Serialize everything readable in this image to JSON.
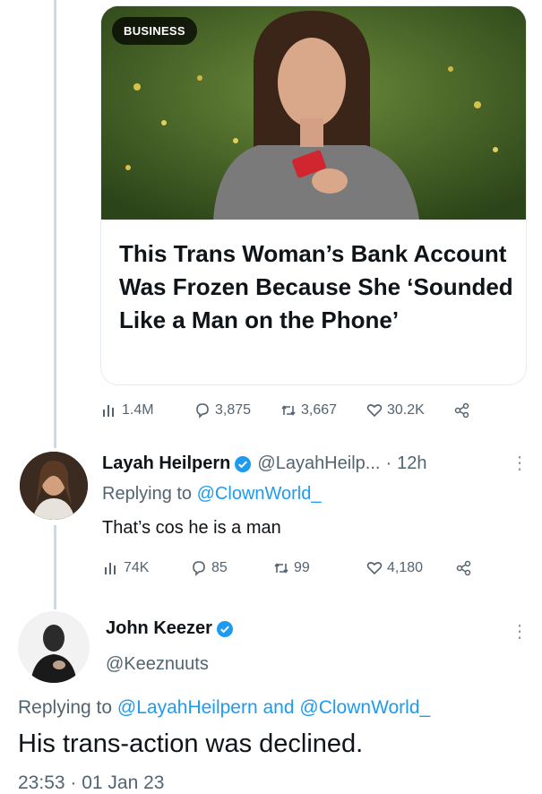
{
  "colors": {
    "link": "#1d9bf0",
    "muted": "#536471",
    "verified": "#1d9bf0",
    "thread_line": "#cfd9de"
  },
  "article_card": {
    "badge": "BUSINESS",
    "headline": "This Trans Woman’s Bank Account Was Frozen Because She ‘Sounded Like a Man on the Phone’"
  },
  "original_tweet_stats": {
    "views": "1.4M",
    "replies": "3,875",
    "retweets": "3,667",
    "likes": "30.2K"
  },
  "reply_1": {
    "name": "Layah Heilpern",
    "handle": "@LayahHeilp...",
    "separator": "·",
    "time": "12h",
    "replying_prefix": "Replying to",
    "replying_to": "@ClownWorld_",
    "text": "That’s cos he is a man",
    "stats": {
      "views": "74K",
      "replies": "85",
      "retweets": "99",
      "likes": "4,180"
    }
  },
  "reply_2": {
    "name": "John Keezer",
    "handle": "@Keeznuuts",
    "replying_prefix": "Replying to",
    "replying_user_1": "@LayahHeilpern",
    "replying_and": "and",
    "replying_user_2": "@ClownWorld_",
    "text": "His trans-action was declined.",
    "timestamp": "23:53 · 01 Jan 23"
  }
}
